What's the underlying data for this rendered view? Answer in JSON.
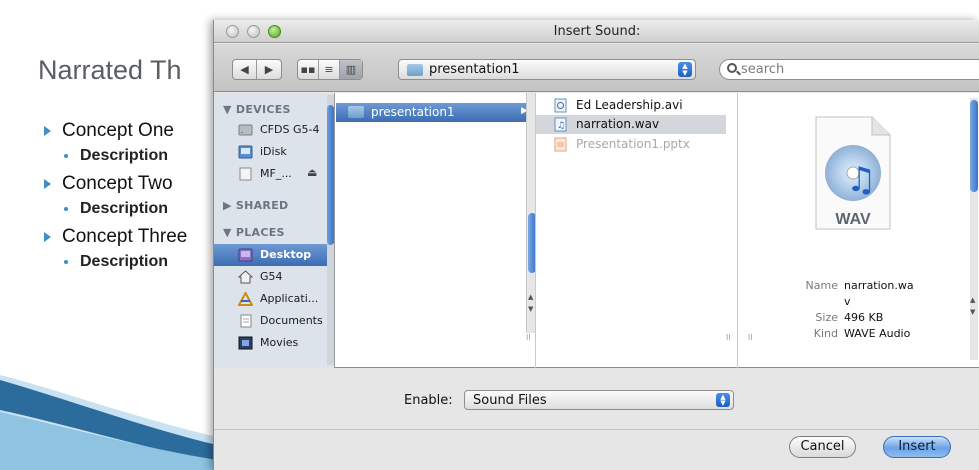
{
  "slide": {
    "title": "Narrated Th",
    "bullets": [
      {
        "label": "Concept One",
        "sub": "Description"
      },
      {
        "label": "Concept Two",
        "sub": "Description"
      },
      {
        "label": "Concept Three",
        "sub": "Description"
      }
    ]
  },
  "dialog": {
    "title": "Insert Sound:",
    "toolbar": {
      "back_icon": "chevron-left-icon",
      "forward_icon": "chevron-right-icon",
      "view_icons": [
        "icon-view-icon",
        "list-view-icon",
        "column-view-icon"
      ],
      "location": "presentation1",
      "search_placeholder": "search"
    },
    "sidebar": {
      "devices_header": "DEVICES",
      "devices": [
        {
          "label": "CFDS G5-4",
          "icon": "hard-drive-icon"
        },
        {
          "label": "iDisk",
          "icon": "idisk-icon"
        },
        {
          "label": "MF_...",
          "icon": "removable-disk-icon"
        }
      ],
      "eject_icon": "eject-icon",
      "shared_header": "SHARED",
      "places_header": "PLACES",
      "places": [
        {
          "label": "Desktop",
          "icon": "desktop-icon"
        },
        {
          "label": "G54",
          "icon": "home-icon"
        },
        {
          "label": "Applicati...",
          "icon": "applications-icon"
        },
        {
          "label": "Documents",
          "icon": "documents-icon"
        },
        {
          "label": "Movies",
          "icon": "movies-icon"
        }
      ]
    },
    "column1": [
      {
        "label": "presentation1",
        "icon": "folder-icon"
      }
    ],
    "column2": [
      {
        "label": "Ed Leadership.avi",
        "icon": "video-file-icon"
      },
      {
        "label": "narration.wav",
        "icon": "audio-file-icon"
      },
      {
        "label": "Presentation1.pptx",
        "icon": "powerpoint-file-icon"
      }
    ],
    "preview": {
      "icon": "wav-file-icon",
      "icon_label": "WAV",
      "name_key": "Name",
      "name_value_line1": "narration.wa",
      "name_value_line2": "v",
      "size_key": "Size",
      "size_value": "496 KB",
      "kind_key": "Kind",
      "kind_value": "WAVE Audio"
    },
    "footer": {
      "enable_label": "Enable:",
      "enable_value": "Sound Files",
      "cancel_label": "Cancel",
      "insert_label": "Insert"
    }
  }
}
